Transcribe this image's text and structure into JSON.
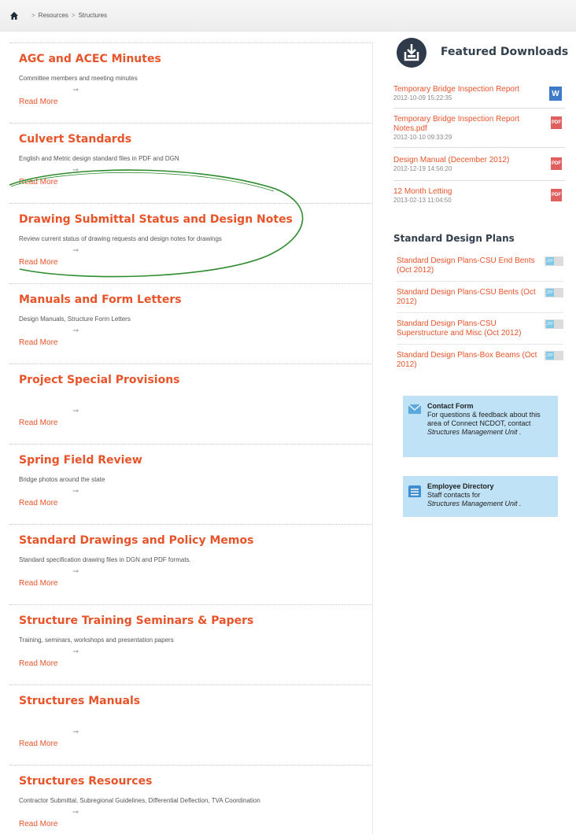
{
  "breadcrumb": {
    "items": [
      "Resources",
      "Structures"
    ],
    "separator": ">"
  },
  "items": [
    {
      "title": "AGC and ACEC Minutes",
      "desc": "Committee members and meeting minutes",
      "more": "Read More"
    },
    {
      "title": "Culvert Standards",
      "desc": "English and Metric design standard files in PDF and DGN",
      "more": "Read More"
    },
    {
      "title": "Drawing Submittal Status and Design Notes",
      "desc": "Review current status of drawing requests and design notes for drawings",
      "more": "Read More"
    },
    {
      "title": "Manuals and Form Letters",
      "desc": "Design Manuals, Structure Form Letters",
      "more": "Read More"
    },
    {
      "title": "Project Special Provisions",
      "desc": "",
      "more": "Read More"
    },
    {
      "title": "Spring Field Review",
      "desc": "Bridge photos around the state",
      "more": "Read More"
    },
    {
      "title": "Standard Drawings and Policy Memos",
      "desc": "Standard specification drawing files in DGN and PDF formats.",
      "more": "Read More"
    },
    {
      "title": "Structure Training Seminars & Papers",
      "desc": "Training, seminars, workshops and presentation papers",
      "more": "Read More"
    },
    {
      "title": "Structures Manuals",
      "desc": "",
      "more": "Read More"
    },
    {
      "title": "Structures Resources",
      "desc": "Contractor Submittal, Subregional Guidelines, Differential Deflection, TVA Coordination",
      "more": "Read More"
    }
  ],
  "featured": {
    "title": "Featured Downloads",
    "downloads": [
      {
        "name": "Temporary Bridge Inspection Report",
        "date": "2012-10-09 15:22:35",
        "type": "W"
      },
      {
        "name": "Temporary Bridge Inspection Report Notes.pdf",
        "date": "2012-10-10 09:33:29",
        "type": "PDF"
      },
      {
        "name": "Design Manual (December 2012)",
        "date": "2012-12-19 14:56:20",
        "type": "PDF"
      },
      {
        "name": "12 Month Letting",
        "date": "2013-02-13 11:04:50",
        "type": "PDF"
      }
    ]
  },
  "standard_plans": {
    "title": "Standard Design Plans",
    "badge": "ZIP",
    "items": [
      "Standard Design Plans-CSU End Bents (Oct 2012)",
      "Standard Design Plans-CSU Bents (Oct 2012)",
      "Standard Design Plans-CSU Superstructure and Misc (Oct 2012)",
      "Standard Design Plans-Box Beams (Oct 2012)"
    ]
  },
  "contact": {
    "title": "Contact Form",
    "text": "For questions & feedback about this area of Connect NCDOT, contact",
    "unit": "Structures Management Unit ."
  },
  "directory": {
    "title": "Employee Directory",
    "text": "Staff contacts for",
    "unit": "Structures Management Unit ."
  },
  "colors": {
    "accent": "#e8542a",
    "box": "#bfe2f7",
    "highlight": "#2e8b2e"
  }
}
